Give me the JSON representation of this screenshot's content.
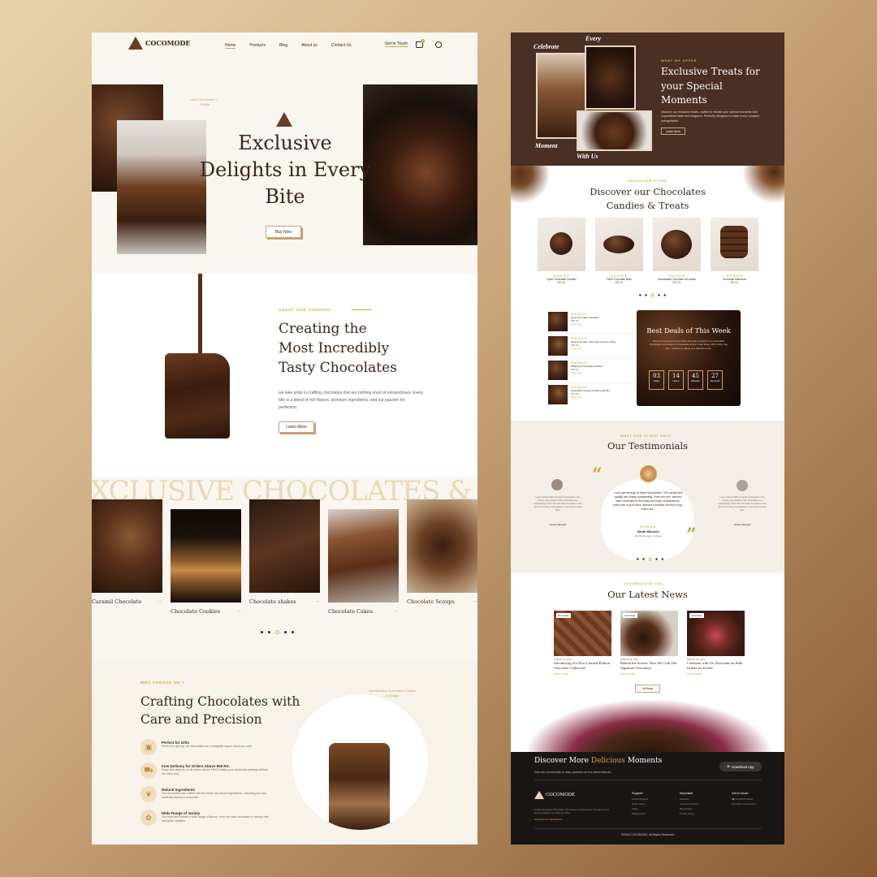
{
  "left": {
    "logo": "COCOMODE",
    "nav": [
      "Home",
      "Products",
      "Blog",
      "About us",
      "Contact Us"
    ],
    "get_in_touch": "Get in Touch",
    "cart_count": "0",
    "hero": {
      "circle_text": "Handcrafted Chocolates Crafted to Delight",
      "title_lines": [
        "Exclusive",
        "Delights in Every",
        "Bite"
      ],
      "button": "Buy Now"
    },
    "about": {
      "label": "ABOUT OUR COMAPNY",
      "title_lines": [
        "Creating the",
        "Most Incredibly",
        "Tasty Chocolates"
      ],
      "text": "we take pride in crafting chocolates that are nothing short of extraordinary. Every bite is a blend of rich flavors, premium ingredients, and our passion for perfection.",
      "button": "Learn More"
    },
    "marquee": "XCLUSIVE CHOCOLATES & TREAT",
    "categories": [
      {
        "name": "Caramil Chocolate"
      },
      {
        "name": "Chocolate Cookies"
      },
      {
        "name": "Chocolate shakes"
      },
      {
        "name": "Chocolate Cakes"
      },
      {
        "name": "Chocolate Scoups"
      }
    ],
    "why": {
      "label": "WHY CHOOSE US ?",
      "title_lines": [
        "Crafting Chocolates with",
        "Care and Precision"
      ],
      "circle_text": "Handcrafted Chocolates Crafted to Delight",
      "features": [
        {
          "title": "Perfect for Gifts",
          "text": "Perfect for gift-ing, our chocolates are a delightful way to show you care.",
          "icon": "gift-icon"
        },
        {
          "title": "Free Delivery for Orders Above 500 RS.",
          "text": "Enjoy free delivery on all orders above ₹500! Satisfy your chocolate cravings without the extra cost.",
          "icon": "truck-icon"
        },
        {
          "title": "Natural Ingredients",
          "text": "Our chocolates are crafted with the finest, all-natural ingredients, ensuring pure and authentic flavors in every bite.",
          "icon": "leaf-icon"
        },
        {
          "title": "Wide Range of Variety",
          "text": "Our collection boasts a wide range of flavors, from rich dark chocolate to creamy milk and white varieties.",
          "icon": "variety-icon"
        }
      ]
    }
  },
  "right": {
    "treats": {
      "script_words": [
        "Celebrate",
        "Every",
        "Moment",
        "With Us"
      ],
      "label": "WHAT WE OFFER",
      "title_lines": [
        "Exclusive Treats for",
        "your Special",
        "Moments"
      ],
      "text": "Discover our exclusive treats, crafted to elevate your special moments with unparalleled taste and elegance. Perfectly designed to make every occasion unforgettable.",
      "button": "Learn More"
    },
    "store": {
      "label": "CHOCOLATE STORE",
      "title_lines": [
        "Discover our Chocolates",
        "Candies & Treats"
      ],
      "products": [
        {
          "name": "Hydro Chocolate Candies",
          "price": "390 Rs."
        },
        {
          "name": "Filled Chocolate Balls",
          "price": "489 Rs."
        },
        {
          "name": "Homemade Chocolate Ice-cream",
          "price": "599 Rs."
        },
        {
          "name": "Chocolate Macarons",
          "price": "399 Rs."
        }
      ],
      "stars": "★★★★★"
    },
    "deals": {
      "list": [
        {
          "name": "Dark Chocolate Cupcakes",
          "price": "389 Rs.",
          "link": "Shop Now"
        },
        {
          "name": "Dark Chocolate Tube with Coconut Swirls",
          "price": "489 Rs.",
          "link": "Shop Now"
        },
        {
          "name": "Wrapping Chocolate Candies",
          "price": "389 Rs.",
          "link": "Shop Now"
        },
        {
          "name": "Chocolate Custard Pudding Gift Box",
          "price": "489 Rs.",
          "link": "Shop Now"
        }
      ],
      "title": "Best Deals of This Week",
      "text": "Discover this week's best deals and treat yourself to our irresistible chocolates and sweets at unbeatable prices. Grab these offers while they last – perfect for gifting or a delicious treat.",
      "countdown": [
        {
          "value": "03",
          "unit": "Days"
        },
        {
          "value": "14",
          "unit": "Hours"
        },
        {
          "value": "45",
          "unit": "Minutes"
        },
        {
          "value": "27",
          "unit": "Seconds"
        }
      ]
    },
    "testimonials": {
      "label": "WHAT OUR CLIENT SAYS",
      "title": "Our Testimonials",
      "quote": "I can't get enough of these chocolates! The variety and quality are simply outstanding. From the rich, smooth dark chocolate to the fruity and nutty combinations, every bite is pure bliss. And the customer service is top-notch too.",
      "name": "Sarah Mitchell",
      "role": "Chocolate Lover, Chicago",
      "side_text": "Lorem ipsum dolor sit amet consectetur. The variety and quality of the chocolates are outstanding. From the rich dark chocolate to the fruity and nutty combinations, every bite is pure bliss.",
      "side_name": "Nicole Maxwell"
    },
    "news": {
      "label": "COCOMODE BLOGS",
      "title": "Our Latest News",
      "tag": "Chocolate",
      "posts": [
        {
          "date": "MARCH 12, 2024",
          "title": "Introducing Our New Limited-Edition Chocolate Collection!",
          "link": "READ MORE"
        },
        {
          "date": "MARCH 22, 2024",
          "title": "Behind the Scenes: How We Craft Our Signature Chocolates",
          "link": "READ MORE"
        },
        {
          "date": "MARCH 28, 2024",
          "title": "Celebrate with Us: Discounts on Bulk Orders for Events",
          "link": "READ MORE"
        }
      ],
      "all_button": "All Blogs"
    },
    "footer": {
      "title_pre": "Discover More ",
      "title_accent": "Delicious",
      "title_post": " Moments",
      "subtitle": "Join our community to stay updated on the latest flavors.",
      "app_button": "Download App",
      "logo": "COCOMODE",
      "about": "Crafting Exquisite Chocolates with Passion and Perfection. Bringing Joy to Every Occasion, One Bite at a Time.",
      "subscribe": "Subscribe for Newsletters",
      "col1": {
        "title": "Support",
        "items": [
          "Contact Support",
          "Order Status",
          "FAQs",
          "Shipping Info"
        ]
      },
      "col2": {
        "title": "Important",
        "items": [
          "About Us",
          "Customer Reviews",
          "Blog Articles",
          "Privacy Policy"
        ]
      },
      "col3": {
        "title": "Get in touch",
        "items": [
          "+91 98765 43210",
          "info@cocomode.com"
        ]
      },
      "copyright": "©2024 COCOMODE, All Rights Reserved"
    }
  },
  "colors": {
    "gold": "#d7a13c",
    "dark": "#3b2418",
    "cream": "#f9f6f0",
    "brown": "#4a2f25",
    "footer": "#1b1616"
  }
}
